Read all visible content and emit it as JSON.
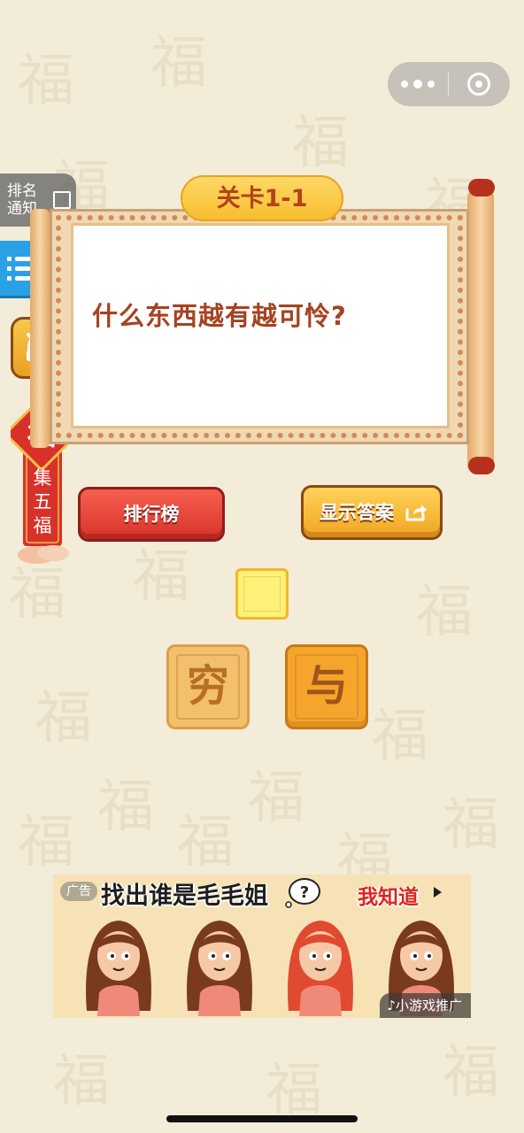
{
  "capsule": {
    "more_icon": "more-dots-icon",
    "close_icon": "target-circle-icon"
  },
  "rank_notify": {
    "line1": "排名",
    "line2": "通知"
  },
  "menu": {
    "icon": "list-menu-icon",
    "badge_color": "#f03b2a"
  },
  "mute": {
    "icon": "headphone-muted-icon"
  },
  "fu_badge": {
    "glyph": "福",
    "label": "集五福"
  },
  "level": {
    "title": "关卡1-1"
  },
  "question": {
    "text": "什么东西越有越可怜?"
  },
  "buttons": {
    "rank": "排行榜",
    "show_answer": "显示答案",
    "share_icon": "share-icon"
  },
  "answer_slots": [
    {
      "value": ""
    }
  ],
  "tiles": [
    {
      "char": "穷"
    },
    {
      "char": "与"
    }
  ],
  "ad": {
    "label": "广告",
    "title": "找出谁是毛毛姐",
    "cta": "我知道",
    "promo": "♪小游戏推广"
  },
  "colors": {
    "background": "#f3ecd8",
    "question": "#a64222",
    "rank_button": "#e2433a",
    "answer_button": "#f7c03e",
    "tile_light": "#f2bf6c",
    "tile_dark": "#f6a52c"
  }
}
